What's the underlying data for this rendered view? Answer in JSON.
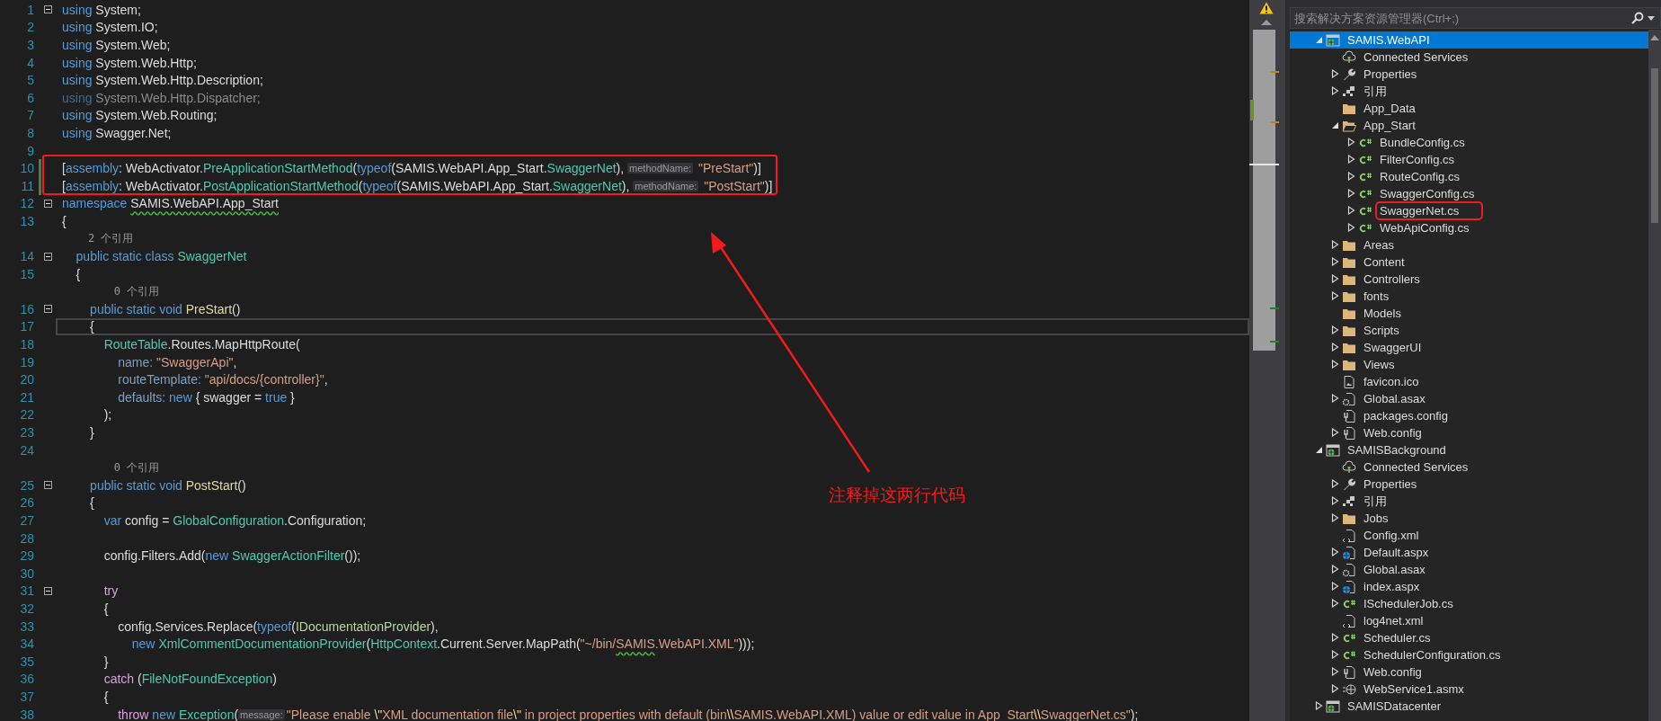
{
  "editor": {
    "lines": [
      {
        "kind": "code",
        "number": "1",
        "foldable": true,
        "changed": false,
        "current": false,
        "tokens": [
          {
            "kind": "kw",
            "text": "using"
          },
          {
            "kind": "plain",
            "text": " System;"
          }
        ]
      },
      {
        "kind": "code",
        "number": "2",
        "foldable": false,
        "changed": false,
        "current": false,
        "tokens": [
          {
            "kind": "kw",
            "text": "using"
          },
          {
            "kind": "plain",
            "text": " System.IO;"
          }
        ]
      },
      {
        "kind": "code",
        "number": "3",
        "foldable": false,
        "changed": false,
        "current": false,
        "tokens": [
          {
            "kind": "kw",
            "text": "using"
          },
          {
            "kind": "plain",
            "text": " System.Web;"
          }
        ]
      },
      {
        "kind": "code",
        "number": "4",
        "foldable": false,
        "changed": false,
        "current": false,
        "tokens": [
          {
            "kind": "kw",
            "text": "using"
          },
          {
            "kind": "plain",
            "text": " System.Web.Http;"
          }
        ]
      },
      {
        "kind": "code",
        "number": "5",
        "foldable": false,
        "changed": false,
        "current": false,
        "tokens": [
          {
            "kind": "kw",
            "text": "using"
          },
          {
            "kind": "plain",
            "text": " System.Web.Http.Description;"
          }
        ]
      },
      {
        "kind": "code",
        "number": "6",
        "foldable": false,
        "changed": false,
        "current": false,
        "tokens": [
          {
            "kind": "dimkw",
            "text": "using"
          },
          {
            "kind": "dim",
            "text": " System.Web.Http.Dispatcher;"
          }
        ]
      },
      {
        "kind": "code",
        "number": "7",
        "foldable": false,
        "changed": false,
        "current": false,
        "tokens": [
          {
            "kind": "kw",
            "text": "using"
          },
          {
            "kind": "plain",
            "text": " System.Web.Routing;"
          }
        ]
      },
      {
        "kind": "code",
        "number": "8",
        "foldable": false,
        "changed": false,
        "current": false,
        "tokens": [
          {
            "kind": "kw",
            "text": "using"
          },
          {
            "kind": "plain",
            "text": " Swagger.Net;"
          }
        ]
      },
      {
        "kind": "code",
        "number": "9",
        "foldable": false,
        "changed": false,
        "current": false
      },
      {
        "kind": "code",
        "number": "10",
        "foldable": false,
        "changed": true,
        "current": false,
        "tokens": [
          {
            "kind": "plain",
            "text": "["
          },
          {
            "kind": "kw",
            "text": "assembly"
          },
          {
            "kind": "plain",
            "text": ": WebActivator."
          },
          {
            "kind": "type",
            "text": "PreApplicationStartMethod"
          },
          {
            "kind": "plain",
            "text": "("
          },
          {
            "kind": "kw",
            "text": "typeof"
          },
          {
            "kind": "plain",
            "text": "(SAMIS.WebAPI.App_Start."
          },
          {
            "kind": "type",
            "text": "SwaggerNet"
          },
          {
            "kind": "plain",
            "text": "), "
          },
          {
            "kind": "hint",
            "text": "methodName:"
          },
          {
            "kind": "str",
            "text": " \"PreStart\""
          },
          {
            "kind": "plain",
            "text": ")]"
          }
        ]
      },
      {
        "kind": "code",
        "number": "11",
        "foldable": false,
        "changed": true,
        "current": false,
        "tokens": [
          {
            "kind": "plain",
            "text": "["
          },
          {
            "kind": "kw",
            "text": "assembly"
          },
          {
            "kind": "plain",
            "text": ": WebActivator."
          },
          {
            "kind": "type",
            "text": "PostApplicationStartMethod"
          },
          {
            "kind": "plain",
            "text": "("
          },
          {
            "kind": "kw",
            "text": "typeof"
          },
          {
            "kind": "plain",
            "text": "(SAMIS.WebAPI.App_Start."
          },
          {
            "kind": "type",
            "text": "SwaggerNet"
          },
          {
            "kind": "plain",
            "text": "), "
          },
          {
            "kind": "hint",
            "text": "methodName:"
          },
          {
            "kind": "str",
            "text": " \"PostStart\""
          },
          {
            "kind": "plain",
            "text": ")]"
          }
        ]
      },
      {
        "kind": "code",
        "number": "12",
        "foldable": true,
        "changed": false,
        "current": false,
        "tokens": [
          {
            "kind": "kw",
            "text": "namespace "
          },
          {
            "kind": "warn",
            "text": "SAMIS.WebAPI.App_Start"
          }
        ]
      },
      {
        "kind": "code",
        "number": "13",
        "foldable": false,
        "changed": false,
        "current": false,
        "tokens": [
          {
            "kind": "plain",
            "text": "{"
          }
        ]
      },
      {
        "kind": "lens",
        "text": "    2 个引用"
      },
      {
        "kind": "code",
        "number": "14",
        "foldable": true,
        "changed": false,
        "current": false,
        "tokens": [
          {
            "kind": "kw",
            "text": "    public static class "
          },
          {
            "kind": "type",
            "text": "SwaggerNet"
          }
        ]
      },
      {
        "kind": "code",
        "number": "15",
        "foldable": false,
        "changed": false,
        "current": false,
        "tokens": [
          {
            "kind": "plain",
            "text": "    {"
          }
        ]
      },
      {
        "kind": "lens",
        "text": "        0 个引用"
      },
      {
        "kind": "code",
        "number": "16",
        "foldable": true,
        "changed": false,
        "current": false,
        "tokens": [
          {
            "kind": "kw",
            "text": "        public static void "
          },
          {
            "kind": "fn",
            "text": "PreStart"
          },
          {
            "kind": "plain",
            "text": "()"
          }
        ]
      },
      {
        "kind": "code",
        "number": "17",
        "foldable": false,
        "changed": false,
        "current": true,
        "tokens": [
          {
            "kind": "plain",
            "text": "        {"
          }
        ]
      },
      {
        "kind": "code",
        "number": "18",
        "foldable": false,
        "changed": false,
        "current": false,
        "tokens": [
          {
            "kind": "type",
            "text": "            RouteTable"
          },
          {
            "kind": "plain",
            "text": ".Routes.MapHttpRoute("
          }
        ]
      },
      {
        "kind": "code",
        "number": "19",
        "foldable": false,
        "changed": false,
        "current": false,
        "tokens": [
          {
            "kind": "param",
            "text": "                name:"
          },
          {
            "kind": "str",
            "text": " \"SwaggerApi\""
          },
          {
            "kind": "plain",
            "text": ","
          }
        ]
      },
      {
        "kind": "code",
        "number": "20",
        "foldable": false,
        "changed": false,
        "current": false,
        "tokens": [
          {
            "kind": "param",
            "text": "                routeTemplate:"
          },
          {
            "kind": "str",
            "text": " \"api/docs/{controller}\""
          },
          {
            "kind": "plain",
            "text": ","
          }
        ]
      },
      {
        "kind": "code",
        "number": "21",
        "foldable": false,
        "changed": false,
        "current": false,
        "tokens": [
          {
            "kind": "param",
            "text": "                defaults:"
          },
          {
            "kind": "kw",
            "text": " new"
          },
          {
            "kind": "plain",
            "text": " { swagger = "
          },
          {
            "kind": "kw",
            "text": "true"
          },
          {
            "kind": "plain",
            "text": " }"
          }
        ]
      },
      {
        "kind": "code",
        "number": "22",
        "foldable": false,
        "changed": false,
        "current": false,
        "tokens": [
          {
            "kind": "plain",
            "text": "            );"
          }
        ]
      },
      {
        "kind": "code",
        "number": "23",
        "foldable": false,
        "changed": false,
        "current": false,
        "tokens": [
          {
            "kind": "plain",
            "text": "        }"
          }
        ]
      },
      {
        "kind": "code",
        "number": "24",
        "foldable": false,
        "changed": false,
        "current": false
      },
      {
        "kind": "lens",
        "text": "        0 个引用"
      },
      {
        "kind": "code",
        "number": "25",
        "foldable": true,
        "changed": false,
        "current": false,
        "tokens": [
          {
            "kind": "kw",
            "text": "        public static void "
          },
          {
            "kind": "fn",
            "text": "PostStart"
          },
          {
            "kind": "plain",
            "text": "()"
          }
        ]
      },
      {
        "kind": "code",
        "number": "26",
        "foldable": false,
        "changed": false,
        "current": false,
        "tokens": [
          {
            "kind": "plain",
            "text": "        {"
          }
        ]
      },
      {
        "kind": "code",
        "number": "27",
        "foldable": false,
        "changed": false,
        "current": false,
        "tokens": [
          {
            "kind": "kw",
            "text": "            var"
          },
          {
            "kind": "plain",
            "text": " config = "
          },
          {
            "kind": "type",
            "text": "GlobalConfiguration"
          },
          {
            "kind": "plain",
            "text": ".Configuration;"
          }
        ]
      },
      {
        "kind": "code",
        "number": "28",
        "foldable": false,
        "changed": false,
        "current": false
      },
      {
        "kind": "code",
        "number": "29",
        "foldable": false,
        "changed": false,
        "current": false,
        "tokens": [
          {
            "kind": "plain",
            "text": "            config.Filters.Add("
          },
          {
            "kind": "kw",
            "text": "new "
          },
          {
            "kind": "type",
            "text": "SwaggerActionFilter"
          },
          {
            "kind": "plain",
            "text": "());"
          }
        ]
      },
      {
        "kind": "code",
        "number": "30",
        "foldable": false,
        "changed": false,
        "current": false
      },
      {
        "kind": "code",
        "number": "31",
        "foldable": true,
        "changed": false,
        "current": false,
        "tokens": [
          {
            "kind": "ctrl",
            "text": "            try"
          }
        ]
      },
      {
        "kind": "code",
        "number": "32",
        "foldable": false,
        "changed": false,
        "current": false,
        "tokens": [
          {
            "kind": "plain",
            "text": "            {"
          }
        ]
      },
      {
        "kind": "code",
        "number": "33",
        "foldable": false,
        "changed": false,
        "current": false,
        "tokens": [
          {
            "kind": "plain",
            "text": "                config.Services.Replace("
          },
          {
            "kind": "kw",
            "text": "typeof"
          },
          {
            "kind": "plain",
            "text": "("
          },
          {
            "kind": "iface",
            "text": "IDocumentationProvider"
          },
          {
            "kind": "plain",
            "text": "),"
          }
        ]
      },
      {
        "kind": "code",
        "number": "34",
        "foldable": false,
        "changed": false,
        "current": false,
        "tokens": [
          {
            "kind": "kw",
            "text": "                    new "
          },
          {
            "kind": "type",
            "text": "XmlCommentDocumentationProvider"
          },
          {
            "kind": "plain",
            "text": "("
          },
          {
            "kind": "type",
            "text": "HttpContext"
          },
          {
            "kind": "plain",
            "text": ".Current.Server.MapPath("
          },
          {
            "kind": "str",
            "text": "\"~/bin/"
          },
          {
            "kind": "warnstr",
            "text": "SAMIS"
          },
          {
            "kind": "str",
            "text": ".WebAPI.XML\""
          },
          {
            "kind": "plain",
            "text": ")));"
          }
        ]
      },
      {
        "kind": "code",
        "number": "35",
        "foldable": false,
        "changed": false,
        "current": false,
        "tokens": [
          {
            "kind": "plain",
            "text": "            }"
          }
        ]
      },
      {
        "kind": "code",
        "number": "36",
        "foldable": false,
        "changed": false,
        "current": false,
        "tokens": [
          {
            "kind": "ctrl",
            "text": "            catch"
          },
          {
            "kind": "plain",
            "text": " ("
          },
          {
            "kind": "type",
            "text": "FileNotFoundException"
          },
          {
            "kind": "plain",
            "text": ")"
          }
        ]
      },
      {
        "kind": "code",
        "number": "37",
        "foldable": false,
        "changed": false,
        "current": false,
        "tokens": [
          {
            "kind": "plain",
            "text": "            {"
          }
        ]
      },
      {
        "kind": "code",
        "number": "38",
        "foldable": false,
        "changed": false,
        "current": false,
        "tokens": [
          {
            "kind": "ctrl",
            "text": "                throw"
          },
          {
            "kind": "kw",
            "text": " new "
          },
          {
            "kind": "type",
            "text": "Exception"
          },
          {
            "kind": "plain",
            "text": "("
          },
          {
            "kind": "hint",
            "text": "message:"
          },
          {
            "kind": "str",
            "text": "\"Please enable "
          },
          {
            "kind": "esc",
            "text": "\\\""
          },
          {
            "kind": "str",
            "text": "XML documentation file"
          },
          {
            "kind": "esc",
            "text": "\\\""
          },
          {
            "kind": "str",
            "text": " in project properties with default (bin"
          },
          {
            "kind": "esc",
            "text": "\\\\"
          },
          {
            "kind": "str",
            "text": "SAMIS.WebAPI.XML) value or edit value in App_Start"
          },
          {
            "kind": "esc",
            "text": "\\\\"
          },
          {
            "kind": "str",
            "text": "SwaggerNet.cs\""
          },
          {
            "kind": "plain",
            "text": ");"
          }
        ]
      }
    ]
  },
  "annotation": {
    "text": "注释掉这两行代码"
  },
  "explorer": {
    "search": {
      "placeholder": "搜索解决方案资源管理器(Ctrl+;)"
    },
    "tree": [
      {
        "label": "SAMIS.WebAPI",
        "kind": "project",
        "expanded": true,
        "selected": true,
        "boxed": false,
        "children": [
          {
            "label": "Connected Services",
            "kind": "service",
            "selected": false,
            "boxed": false
          },
          {
            "label": "Properties",
            "kind": "wrench",
            "expanded": false,
            "selected": false,
            "boxed": false
          },
          {
            "label": "引用",
            "kind": "refs",
            "expanded": false,
            "selected": false,
            "boxed": false
          },
          {
            "label": "App_Data",
            "kind": "folder",
            "selected": false,
            "boxed": false
          },
          {
            "label": "App_Start",
            "kind": "folder-open",
            "expanded": true,
            "selected": false,
            "boxed": false,
            "children": [
              {
                "label": "BundleConfig.cs",
                "kind": "cs",
                "expanded": false,
                "selected": false,
                "boxed": false
              },
              {
                "label": "FilterConfig.cs",
                "kind": "cs",
                "expanded": false,
                "selected": false,
                "boxed": false
              },
              {
                "label": "RouteConfig.cs",
                "kind": "cs",
                "expanded": false,
                "selected": false,
                "boxed": false
              },
              {
                "label": "SwaggerConfig.cs",
                "kind": "cs",
                "expanded": false,
                "selected": false,
                "boxed": false
              },
              {
                "label": "SwaggerNet.cs",
                "kind": "cs",
                "expanded": false,
                "selected": false,
                "boxed": true
              },
              {
                "label": "WebApiConfig.cs",
                "kind": "cs",
                "expanded": false,
                "selected": false,
                "boxed": false
              }
            ]
          },
          {
            "label": "Areas",
            "kind": "folder",
            "expanded": false,
            "selected": false,
            "boxed": false
          },
          {
            "label": "Content",
            "kind": "folder",
            "expanded": false,
            "selected": false,
            "boxed": false
          },
          {
            "label": "Controllers",
            "kind": "folder",
            "expanded": false,
            "selected": false,
            "boxed": false
          },
          {
            "label": "fonts",
            "kind": "folder",
            "expanded": false,
            "selected": false,
            "boxed": false
          },
          {
            "label": "Models",
            "kind": "folder",
            "selected": false,
            "boxed": false
          },
          {
            "label": "Scripts",
            "kind": "folder",
            "expanded": false,
            "selected": false,
            "boxed": false
          },
          {
            "label": "SwaggerUI",
            "kind": "folder",
            "expanded": false,
            "selected": false,
            "boxed": false
          },
          {
            "label": "Views",
            "kind": "folder",
            "expanded": false,
            "selected": false,
            "boxed": false
          },
          {
            "label": "favicon.ico",
            "kind": "image",
            "selected": false,
            "boxed": false
          },
          {
            "label": "Global.asax",
            "kind": "gearfile",
            "expanded": false,
            "selected": false,
            "boxed": false
          },
          {
            "label": "packages.config",
            "kind": "config",
            "selected": false,
            "boxed": false
          },
          {
            "label": "Web.config",
            "kind": "config",
            "expanded": false,
            "selected": false,
            "boxed": false
          }
        ]
      },
      {
        "label": "SAMISBackground",
        "kind": "project",
        "expanded": true,
        "selected": false,
        "boxed": false,
        "children": [
          {
            "label": "Connected Services",
            "kind": "service",
            "selected": false,
            "boxed": false
          },
          {
            "label": "Properties",
            "kind": "wrench",
            "expanded": false,
            "selected": false,
            "boxed": false
          },
          {
            "label": "引用",
            "kind": "refs",
            "expanded": false,
            "selected": false,
            "boxed": false
          },
          {
            "label": "Jobs",
            "kind": "folder",
            "expanded": false,
            "selected": false,
            "boxed": false
          },
          {
            "label": "Config.xml",
            "kind": "xml",
            "selected": false,
            "boxed": false
          },
          {
            "label": "Default.aspx",
            "kind": "webfile",
            "expanded": false,
            "selected": false,
            "boxed": false
          },
          {
            "label": "Global.asax",
            "kind": "gearfile",
            "expanded": false,
            "selected": false,
            "boxed": false
          },
          {
            "label": "index.aspx",
            "kind": "webfile",
            "expanded": false,
            "selected": false,
            "boxed": false
          },
          {
            "label": "ISchedulerJob.cs",
            "kind": "cs",
            "expanded": false,
            "selected": false,
            "boxed": false
          },
          {
            "label": "log4net.xml",
            "kind": "xml",
            "selected": false,
            "boxed": false
          },
          {
            "label": "Scheduler.cs",
            "kind": "cs",
            "expanded": false,
            "selected": false,
            "boxed": false
          },
          {
            "label": "SchedulerConfiguration.cs",
            "kind": "cs",
            "expanded": false,
            "selected": false,
            "boxed": false
          },
          {
            "label": "Web.config",
            "kind": "config",
            "expanded": false,
            "selected": false,
            "boxed": false
          },
          {
            "label": "WebService1.asmx",
            "kind": "service-globe",
            "expanded": false,
            "selected": false,
            "boxed": false
          }
        ]
      },
      {
        "label": "SAMISDatacenter",
        "kind": "project",
        "expanded": false,
        "selected": false,
        "boxed": false
      }
    ]
  }
}
